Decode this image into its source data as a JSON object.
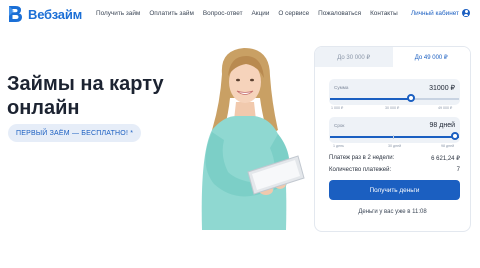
{
  "header": {
    "logo_text": "Вебзайм",
    "nav": [
      "Получить займ",
      "Оплатить займ",
      "Вопрос-ответ",
      "Акции",
      "О сервисе",
      "Пожаловаться",
      "Контакты"
    ],
    "account_label": "Личный кабинет"
  },
  "hero": {
    "title": "Займы на карту онлайн",
    "promo": "ПЕРВЫЙ ЗАЁМ — БЕСПЛАТНО! *"
  },
  "calculator": {
    "tabs": [
      {
        "label": "До 30 000 ₽",
        "active": false
      },
      {
        "label": "До 49 000 ₽",
        "active": true
      }
    ],
    "amount": {
      "label": "Сумма",
      "value": "31000 ₽",
      "ticks": [
        "1 000 ₽",
        "30 000 ₽",
        "49 000 ₽"
      ],
      "fraction": 0.625
    },
    "term": {
      "label": "Срок",
      "value": "98 дней",
      "ticks": [
        "1 день",
        "30 дней",
        "98 дней"
      ],
      "fraction": 1.0
    },
    "payment_label": "Платеж раз в 2 недели:",
    "payment_value": "6 621,24 ₽",
    "count_label": "Количество платежей:",
    "count_value": "7",
    "cta": "Получить деньги",
    "footer": "Деньги у вас уже в 11:08"
  },
  "colors": {
    "brand": "#1b5fc1",
    "panel_bg": "#eef2f7"
  }
}
